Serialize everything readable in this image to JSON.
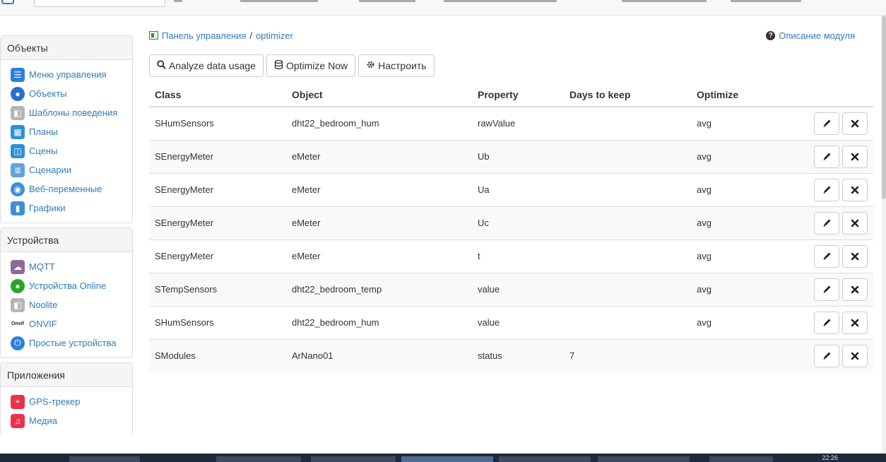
{
  "breadcrumb": {
    "home": "Панель управления",
    "separator": "/",
    "current": "optimizer"
  },
  "module_help": "Описание модуля",
  "toolbar": {
    "analyze": "Analyze data usage",
    "optimize": "Optimize Now",
    "configure": "Настроить"
  },
  "sidebar": {
    "objects": {
      "title": "Объекты",
      "items": [
        {
          "label": "Меню управления",
          "icon": "menu-icon",
          "color": "#2d7ee0"
        },
        {
          "label": "Объекты",
          "icon": "globe-icon",
          "color": "#2a6fcf"
        },
        {
          "label": "Шаблоны поведения",
          "icon": "template-icon",
          "color": "#b5b5b5"
        },
        {
          "label": "Планы",
          "icon": "plans-icon",
          "color": "#2f8fd8"
        },
        {
          "label": "Сцены",
          "icon": "scenes-icon",
          "color": "#2f8fd8"
        },
        {
          "label": "Сценарии",
          "icon": "scripts-icon",
          "color": "#5fa5e0"
        },
        {
          "label": "Веб-переменные",
          "icon": "web-vars-icon",
          "color": "#3b8fd8"
        },
        {
          "label": "Графики",
          "icon": "charts-icon",
          "color": "#3a8fd8"
        }
      ]
    },
    "devices": {
      "title": "Устройства",
      "items": [
        {
          "label": "MQTT",
          "icon": "mqtt-icon",
          "color": "#8e6a9a"
        },
        {
          "label": "Устройства Online",
          "icon": "online-icon",
          "color": "#2aa52a"
        },
        {
          "label": "Noolite",
          "icon": "noolite-icon",
          "color": "#b5b5b5"
        },
        {
          "label": "ONVIF",
          "icon": "onvif-icon",
          "color": "#ffffff",
          "badge": "Onvif"
        },
        {
          "label": "Простые устройства",
          "icon": "power-icon",
          "color": "#2d7ee0"
        }
      ]
    },
    "apps": {
      "title": "Приложения",
      "items": [
        {
          "label": "GPS-трекер",
          "icon": "gps-icon",
          "color": "#e8334a"
        },
        {
          "label": "Медиа",
          "icon": "media-icon",
          "color": "#e8334a"
        }
      ]
    }
  },
  "table": {
    "headers": [
      "Class",
      "Object",
      "Property",
      "Days to keep",
      "Optimize"
    ],
    "rows": [
      {
        "class": "SHumSensors",
        "object": "dht22_bedroom_hum",
        "property": "rawValue",
        "days": "",
        "optimize": "avg"
      },
      {
        "class": "SEnergyMeter",
        "object": "eMeter",
        "property": "Ub",
        "days": "",
        "optimize": "avg"
      },
      {
        "class": "SEnergyMeter",
        "object": "eMeter",
        "property": "Ua",
        "days": "",
        "optimize": "avg"
      },
      {
        "class": "SEnergyMeter",
        "object": "eMeter",
        "property": "Uc",
        "days": "",
        "optimize": "avg"
      },
      {
        "class": "SEnergyMeter",
        "object": "eMeter",
        "property": "t",
        "days": "",
        "optimize": "avg"
      },
      {
        "class": "STempSensors",
        "object": "dht22_bedroom_temp",
        "property": "value",
        "days": "",
        "optimize": "avg"
      },
      {
        "class": "SHumSensors",
        "object": "dht22_bedroom_hum",
        "property": "value",
        "days": "",
        "optimize": "avg"
      },
      {
        "class": "SModules",
        "object": "ArNano01",
        "property": "status",
        "days": "7",
        "optimize": ""
      }
    ]
  },
  "taskbar": {
    "clock": "22:26"
  }
}
